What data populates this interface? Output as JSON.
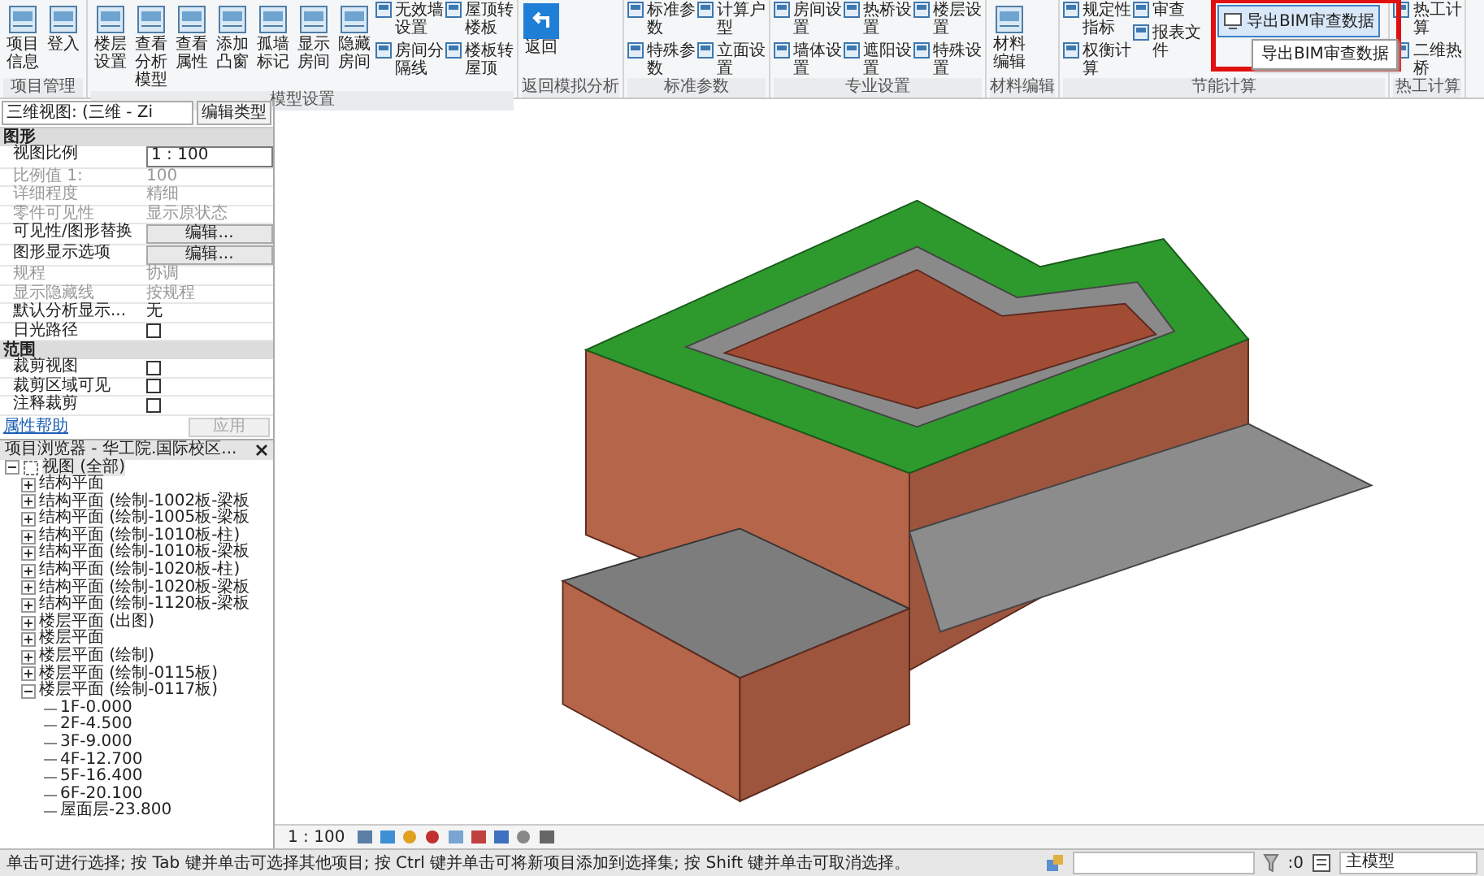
{
  "ribbon": {
    "groups": [
      {
        "label": "项目管理",
        "tools": [
          {
            "kind": "large",
            "label": "项目信息"
          },
          {
            "kind": "large",
            "label": "登入"
          }
        ]
      },
      {
        "label": "模型设置",
        "tools": [
          {
            "kind": "large",
            "label": "楼层设置"
          },
          {
            "kind": "large",
            "label": "查看分析模型"
          },
          {
            "kind": "large",
            "label": "查看属性"
          },
          {
            "kind": "large",
            "label": "添加凸窗"
          },
          {
            "kind": "large",
            "label": "孤墙标记"
          },
          {
            "kind": "large",
            "label": "显示房间"
          },
          {
            "kind": "large",
            "label": "隐藏房间"
          },
          {
            "kind": "stack",
            "items": [
              {
                "label": "无效墙设置"
              },
              {
                "label": "房间分隔线"
              }
            ]
          },
          {
            "kind": "stack",
            "items": [
              {
                "label": "屋顶转楼板"
              },
              {
                "label": "楼板转屋顶"
              }
            ]
          }
        ]
      },
      {
        "label": "返回模拟分析",
        "tools": [
          {
            "kind": "back",
            "label": "返回"
          }
        ]
      },
      {
        "label": "标准参数",
        "tools": [
          {
            "kind": "stack",
            "items": [
              {
                "label": "标准参数"
              },
              {
                "label": "特殊参数"
              }
            ]
          },
          {
            "kind": "stack",
            "items": [
              {
                "label": "计算户型"
              },
              {
                "label": "立面设置"
              }
            ]
          }
        ]
      },
      {
        "label": "专业设置",
        "tools": [
          {
            "kind": "stack",
            "items": [
              {
                "label": "房间设置"
              },
              {
                "label": "墙体设置"
              }
            ]
          },
          {
            "kind": "stack",
            "items": [
              {
                "label": "热桥设置"
              },
              {
                "label": "遮阳设置"
              }
            ]
          },
          {
            "kind": "stack",
            "items": [
              {
                "label": "楼层设置"
              },
              {
                "label": "特殊设置"
              }
            ]
          }
        ]
      },
      {
        "label": "材料编辑",
        "tools": [
          {
            "kind": "large",
            "label": "材料编辑"
          }
        ]
      },
      {
        "label": "节能计算",
        "tools": [
          {
            "kind": "stack",
            "items": [
              {
                "label": "规定性指标"
              },
              {
                "label": "权衡计算"
              }
            ]
          },
          {
            "kind": "stack",
            "items": [
              {
                "label": "审查"
              },
              {
                "label": "报表文件"
              }
            ]
          },
          {
            "kind": "export",
            "label": "导出BIM审查数据",
            "tooltip": "导出BIM审查数据",
            "highlighted": true,
            "framed": true
          }
        ]
      },
      {
        "label": "热工计算",
        "tools": [
          {
            "kind": "stack",
            "items": [
              {
                "label": "热工计算"
              },
              {
                "label": "二维热桥"
              }
            ]
          }
        ]
      }
    ]
  },
  "properties": {
    "type_selector": "三维视图: (三维 - Zi",
    "edit_type": "编辑类型",
    "sections": [
      {
        "title": "图形",
        "rows": [
          {
            "name": "视图比例",
            "kind": "input",
            "value": "1 : 100"
          },
          {
            "name": "比例值 1:",
            "kind": "text",
            "value": "100",
            "disabled": true
          },
          {
            "name": "详细程度",
            "kind": "text",
            "value": "精细",
            "disabled": true
          },
          {
            "name": "零件可见性",
            "kind": "text",
            "value": "显示原状态",
            "disabled": true
          },
          {
            "name": "可见性/图形替换",
            "kind": "button",
            "value": "编辑..."
          },
          {
            "name": "图形显示选项",
            "kind": "button",
            "value": "编辑..."
          },
          {
            "name": "规程",
            "kind": "text",
            "value": "协调",
            "disabled": true
          },
          {
            "name": "显示隐藏线",
            "kind": "text",
            "value": "按规程",
            "disabled": true
          },
          {
            "name": "默认分析显示...",
            "kind": "text",
            "value": "无",
            "disabled": false
          },
          {
            "name": "日光路径",
            "kind": "checkbox",
            "checked": false
          }
        ]
      },
      {
        "title": "范围",
        "rows": [
          {
            "name": "裁剪视图",
            "kind": "checkbox",
            "checked": false
          },
          {
            "name": "裁剪区域可见",
            "kind": "checkbox",
            "checked": false
          },
          {
            "name": "注释裁剪",
            "kind": "checkbox",
            "checked": false
          }
        ]
      }
    ],
    "help_link": "属性帮助",
    "apply": "应用",
    "apply_disabled": true
  },
  "browser": {
    "title": "项目浏览器 - 华工院.国际校区...",
    "tree": [
      {
        "label": "视图 (全部)",
        "expanded": true,
        "selected": true,
        "children": [
          {
            "label": "结构平面",
            "expanded": false,
            "selected": false
          },
          {
            "label": "结构平面 (绘制-1002板-梁板",
            "expanded": false,
            "selected": false
          },
          {
            "label": "结构平面 (绘制-1005板-梁板",
            "expanded": false,
            "selected": false
          },
          {
            "label": "结构平面 (绘制-1010板-柱)",
            "expanded": false,
            "selected": false
          },
          {
            "label": "结构平面 (绘制-1010板-梁板",
            "expanded": false,
            "selected": false
          },
          {
            "label": "结构平面 (绘制-1020板-柱)",
            "expanded": false,
            "selected": false
          },
          {
            "label": "结构平面 (绘制-1020板-梁板",
            "expanded": false,
            "selected": false
          },
          {
            "label": "结构平面 (绘制-1120板-梁板",
            "expanded": false,
            "selected": false
          },
          {
            "label": "楼层平面 (出图)",
            "expanded": false,
            "selected": false
          },
          {
            "label": "楼层平面",
            "expanded": false,
            "selected": false
          },
          {
            "label": "楼层平面 (绘制)",
            "expanded": false,
            "selected": false
          },
          {
            "label": "楼层平面 (绘制-0115板)",
            "expanded": false,
            "selected": false
          },
          {
            "label": "楼层平面 (绘制-0117板)",
            "expanded": true,
            "selected": false,
            "children": [
              {
                "label": "1F-0.000",
                "selected": false
              },
              {
                "label": "2F-4.500",
                "selected": false
              },
              {
                "label": "3F-9.000",
                "selected": false
              },
              {
                "label": "4F-12.700",
                "selected": false
              },
              {
                "label": "5F-16.400",
                "selected": false
              },
              {
                "label": "6F-20.100",
                "selected": false
              },
              {
                "label": "屋面层-23.800",
                "selected": false
              }
            ]
          }
        ]
      }
    ]
  },
  "view_bar": {
    "scale": "1 : 100"
  },
  "status_bar": {
    "message": "单击可进行选择; 按 Tab 键并单击可选择其他项目; 按 Ctrl 键并单击可将新项目添加到选择集; 按 Shift 键并单击可取消选择。",
    "selection_count": ":0",
    "model": "主模型"
  }
}
